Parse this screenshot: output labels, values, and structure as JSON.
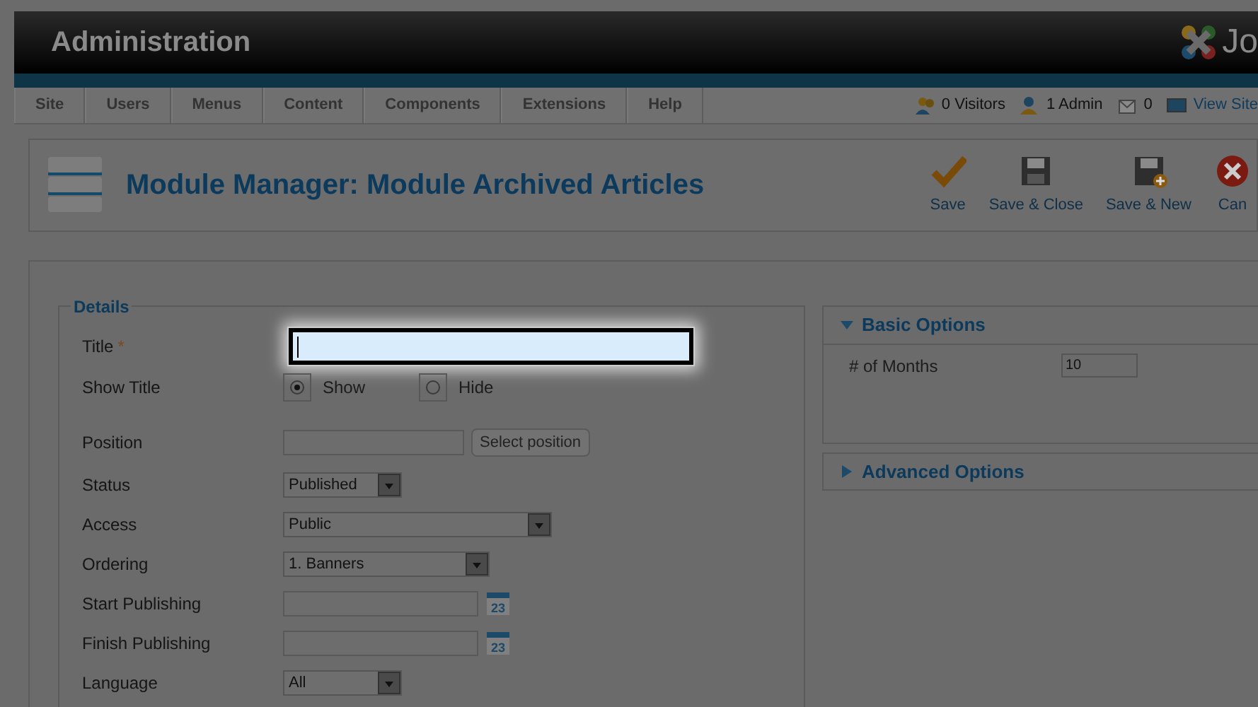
{
  "header": {
    "title": "Administration",
    "logo_text": "Jo"
  },
  "menu": [
    {
      "label": "Site"
    },
    {
      "label": "Users"
    },
    {
      "label": "Menus"
    },
    {
      "label": "Content"
    },
    {
      "label": "Components"
    },
    {
      "label": "Extensions"
    },
    {
      "label": "Help"
    }
  ],
  "status": [
    {
      "kind": "visitors",
      "label": "0 Visitors"
    },
    {
      "kind": "admin",
      "label": "1 Admin"
    },
    {
      "kind": "messages",
      "label": "0"
    },
    {
      "kind": "view",
      "label": "View Site"
    }
  ],
  "toolbar": {
    "title": "Module Manager: Module Archived Articles",
    "buttons": [
      {
        "kind": "save",
        "label": "Save"
      },
      {
        "kind": "save_close",
        "label": "Save & Close"
      },
      {
        "kind": "save_new",
        "label": "Save & New"
      },
      {
        "kind": "cancel",
        "label": "Can"
      }
    ]
  },
  "details": {
    "legend": "Details",
    "fields": [
      {
        "kind": "text",
        "label": "Title",
        "required_mark": "*",
        "focused": true
      },
      {
        "kind": "radio",
        "label": "Show Title",
        "options": [
          {
            "label": "Show",
            "selected": true
          },
          {
            "label": "Hide",
            "selected": false
          }
        ]
      },
      {
        "kind": "text_button",
        "label": "Position",
        "button": "Select position"
      },
      {
        "kind": "select",
        "label": "Status",
        "value": "Published"
      },
      {
        "kind": "select",
        "label": "Access",
        "value": "Public"
      },
      {
        "kind": "select",
        "label": "Ordering",
        "value": "1. Banners"
      },
      {
        "kind": "date",
        "label": "Start Publishing",
        "icon_text": "23"
      },
      {
        "kind": "date",
        "label": "Finish Publishing",
        "icon_text": "23"
      },
      {
        "kind": "select",
        "label": "Language",
        "value": "All"
      }
    ]
  },
  "options": [
    {
      "title": "Basic Options",
      "expanded": true,
      "fields": [
        {
          "label": "# of Months",
          "value": "10"
        }
      ]
    },
    {
      "title": "Advanced Options",
      "expanded": false
    }
  ]
}
